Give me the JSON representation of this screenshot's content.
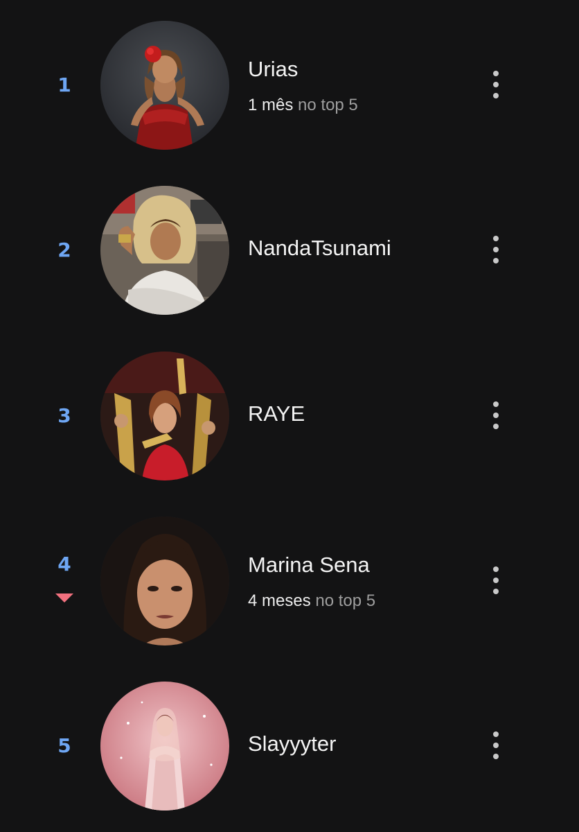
{
  "ranking": {
    "items": [
      {
        "rank": "1",
        "name": "Urias",
        "subtitle_strong": "1 mês",
        "subtitle_muted": "no top 5",
        "trend": "none",
        "avatar_icon": "artist-photo-avatar"
      },
      {
        "rank": "2",
        "name": "NandaTsunami",
        "trend": "none",
        "avatar_icon": "artist-photo-avatar"
      },
      {
        "rank": "3",
        "name": "RAYE",
        "trend": "none",
        "avatar_icon": "artist-photo-avatar"
      },
      {
        "rank": "4",
        "name": "Marina Sena",
        "subtitle_strong": "4 meses",
        "subtitle_muted": "no top 5",
        "trend": "down",
        "avatar_icon": "artist-photo-avatar"
      },
      {
        "rank": "5",
        "name": "Slayyyter",
        "trend": "none",
        "avatar_icon": "artist-photo-avatar"
      }
    ],
    "more_icon": "more-vertical-icon",
    "trend_icon": "trend-down-icon"
  },
  "colors": {
    "background": "#131314",
    "rank": "#6ea6f3",
    "trend_down": "#f2717f",
    "primary_text": "#f4f4f4",
    "secondary_text": "#9e9e9e"
  }
}
